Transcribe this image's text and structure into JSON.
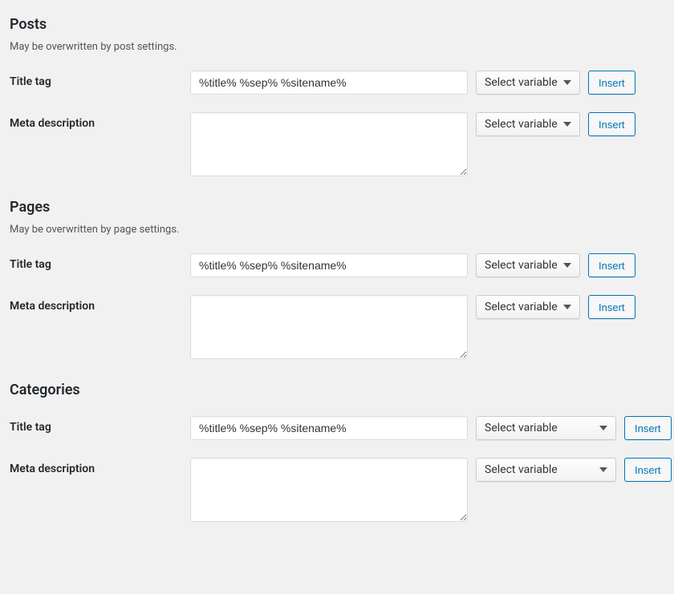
{
  "common": {
    "select_label": "Select variable",
    "insert_label": "Insert",
    "title_label": "Title tag",
    "meta_label": "Meta description"
  },
  "sections": {
    "posts": {
      "heading": "Posts",
      "hint": "May be overwritten by post settings.",
      "title_value": "%title% %sep% %sitename%",
      "meta_value": ""
    },
    "pages": {
      "heading": "Pages",
      "hint": "May be overwritten by page settings.",
      "title_value": "%title% %sep% %sitename%",
      "meta_value": ""
    },
    "categories": {
      "heading": "Categories",
      "title_value": "%title% %sep% %sitename%",
      "meta_value": ""
    }
  }
}
